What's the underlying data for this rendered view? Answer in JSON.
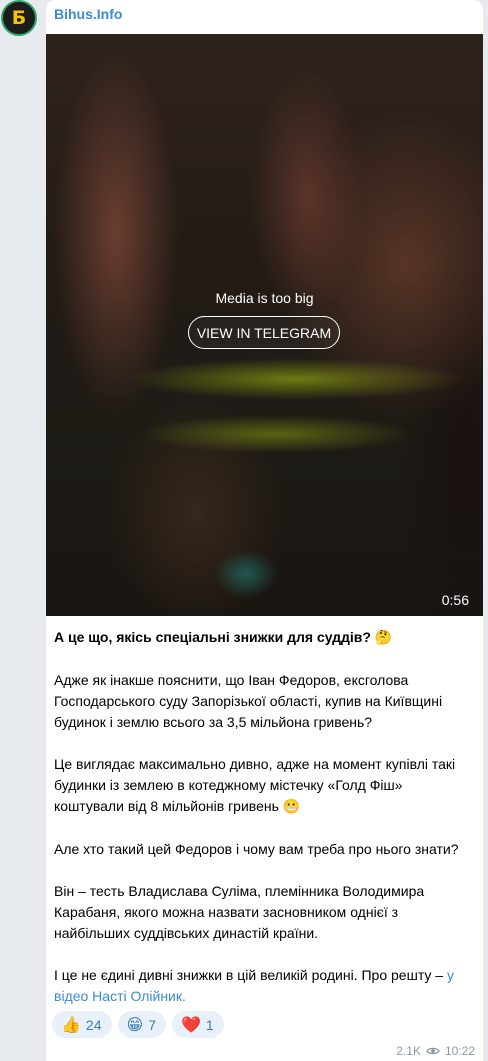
{
  "channel": {
    "name": "Bihus.Info"
  },
  "avatar": {
    "glyph": "Б"
  },
  "media": {
    "notice": "Media is too big",
    "button_label": "VIEW IN TELEGRAM",
    "duration": "0:56"
  },
  "post": {
    "p1": "А це що, якісь спеціальні знижки для суддів?",
    "p1_emoji": "🤔",
    "p2": "Адже як інакше пояснити, що Іван Федоров, ексголова Господарського суду Запорізької області, купив на Київщині будинок і землю всього за 3,5 мільйона гривень?",
    "p3": "Це виглядає максимально дивно, адже на момент купівлі такі будинки із землею в котеджному містечку «Голд Фіш» коштували від 8 мільйонів гривень",
    "p3_emoji": "😬",
    "p4": "Але хто такий цей Федоров і чому вам треба про нього знати?",
    "p5": "Він – тесть Владислава Суліма, племінника Володимира Карабаня, якого можна назвати засновником однієї з найбільших суддівських династій країни.",
    "p6": "І це не єдині дивні знижки в цій великій родині. Про решту –",
    "p6_link": "у відео Насті Олійник."
  },
  "reactions": [
    {
      "emoji": "👍",
      "count": "24"
    },
    {
      "emoji": "😁",
      "count": "7"
    },
    {
      "emoji": "❤️",
      "count": "1"
    }
  ],
  "meta": {
    "views": "2.1K",
    "time": "10:22"
  },
  "colors": {
    "link": "#3a8ccf",
    "background": "#e7ebf0",
    "reaction_bg": "#e8f1f9"
  }
}
